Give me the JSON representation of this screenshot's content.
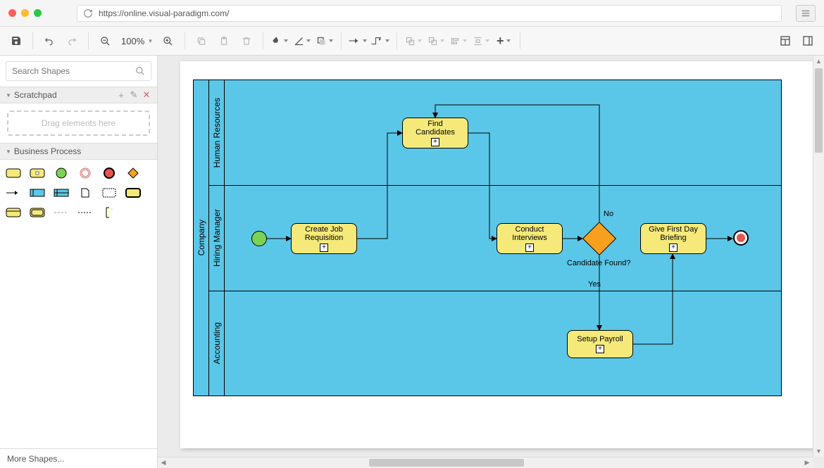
{
  "browser": {
    "url": "https://online.visual-paradigm.com/"
  },
  "toolbar": {
    "zoom": "100%"
  },
  "sidebar": {
    "search_placeholder": "Search Shapes",
    "scratchpad_title": "Scratchpad",
    "scratchpad_drop": "Drag elements here",
    "business_process_title": "Business Process",
    "more_shapes": "More Shapes..."
  },
  "diagram": {
    "pool": "Company",
    "lanes": [
      "Human Resources",
      "Hiring Manager",
      "Accounting"
    ],
    "tasks": {
      "create_job": "Create Job Requisition",
      "find_candidates": "Find Candidates",
      "conduct_interviews": "Conduct Interviews",
      "give_briefing": "Give First Day Briefing",
      "setup_payroll": "Setup Payroll"
    },
    "gateway_label": "Candidate Found?",
    "edge_yes": "Yes",
    "edge_no": "No"
  }
}
